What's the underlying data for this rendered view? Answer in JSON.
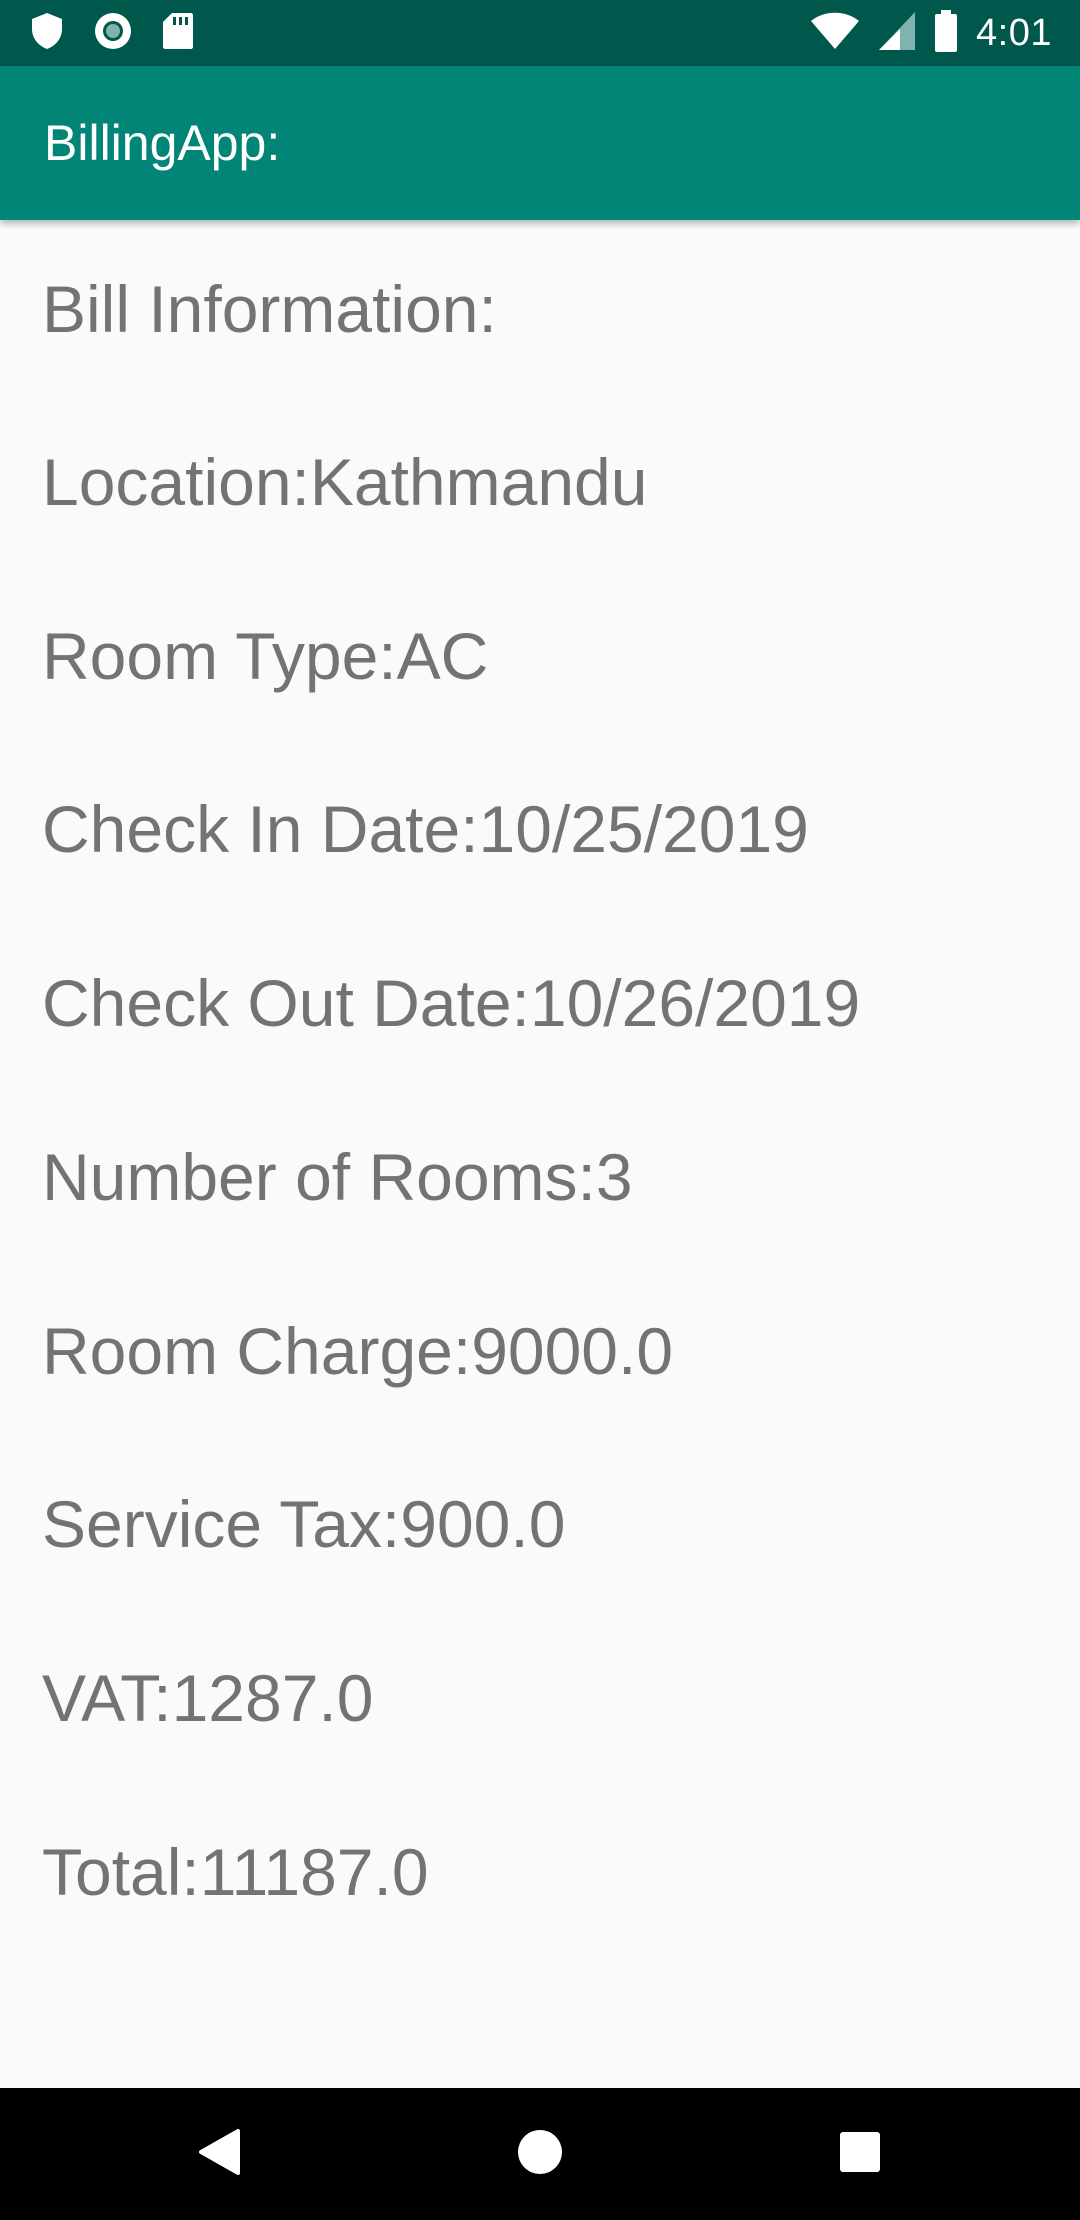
{
  "status_bar": {
    "time": "4:01",
    "left_icons": [
      "shield-icon",
      "circle-record-icon",
      "sd-card-icon"
    ],
    "right_icons": [
      "wifi-icon",
      "cell-signal-icon",
      "battery-icon"
    ],
    "background": "#00574b"
  },
  "app_bar": {
    "title": "BillingApp:",
    "background": "#008577"
  },
  "bill": {
    "heading": "Bill Information:",
    "location": "Location:Kathmandu",
    "room_type": "Room Type:AC",
    "check_in": "Check In Date:10/25/2019",
    "check_out": "Check Out Date:10/26/2019",
    "number_of_rooms": "Number of Rooms:3",
    "room_charge": "Room Charge:9000.0",
    "service_tax": "Service Tax:900.0",
    "vat": "VAT:1287.0",
    "total": "Total:11187.0"
  },
  "nav_bar": {
    "buttons": [
      "back-icon",
      "home-icon",
      "recents-icon"
    ]
  }
}
